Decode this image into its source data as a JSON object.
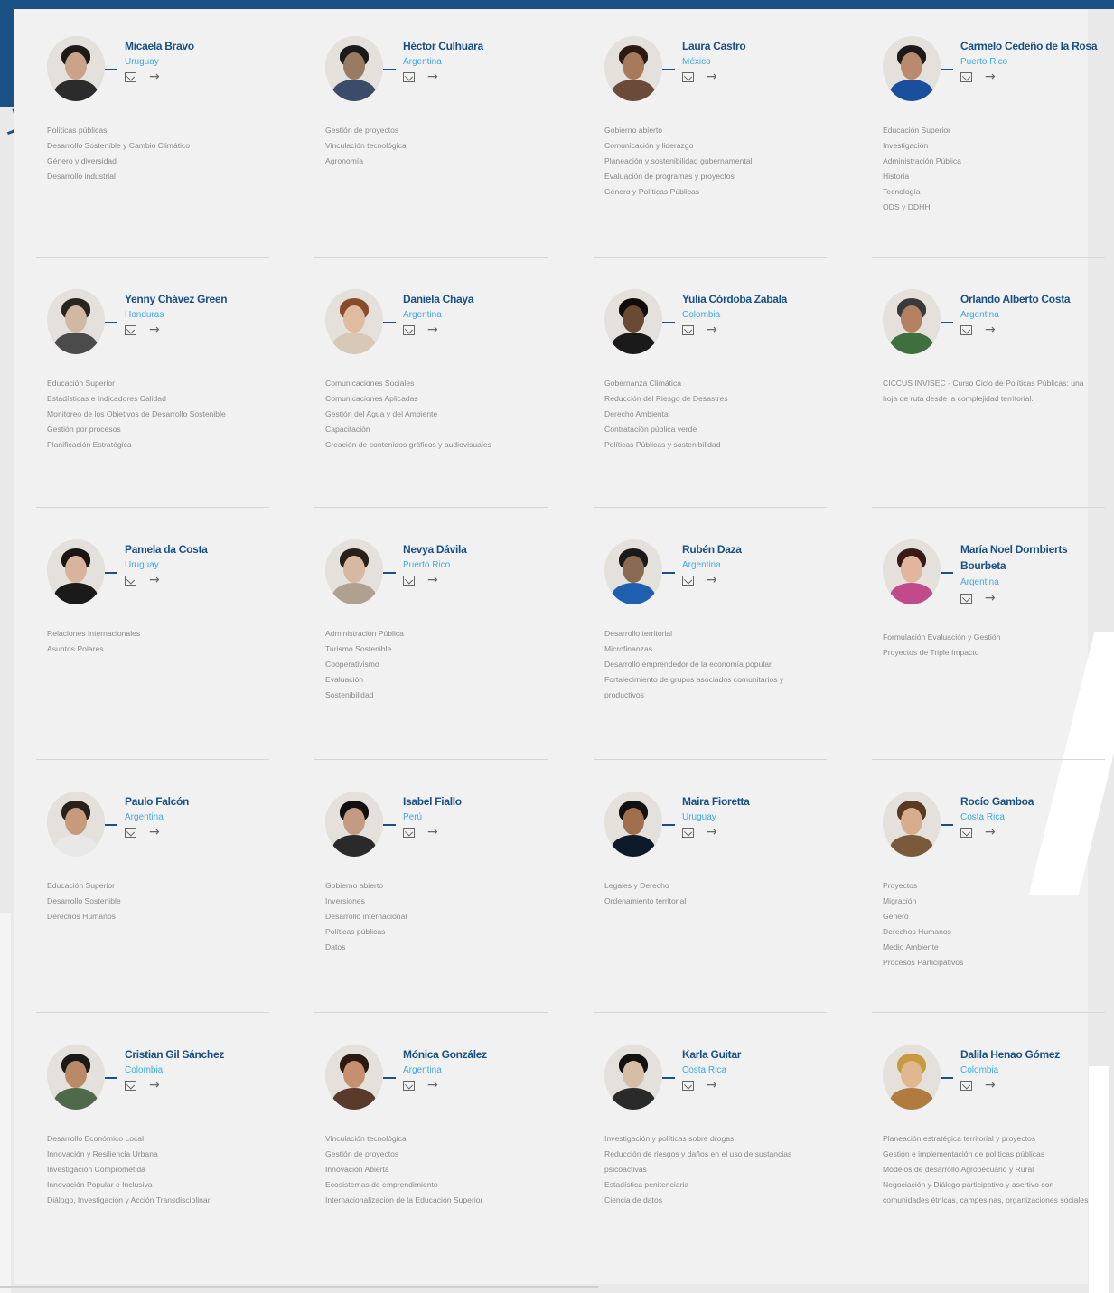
{
  "people": [
    {
      "name": "Micaela Bravo",
      "country": "Uruguay",
      "topics": [
        "Políticas públicas",
        "Desarrollo Sostenible y Cambio Climático",
        "Género y diversidad",
        "Desarrollo industrial"
      ]
    },
    {
      "name": "Héctor Culhuara",
      "country": "Argentina",
      "topics": [
        "Gestión de proyectos",
        "Vinculación tecnológica",
        "Agronomía"
      ]
    },
    {
      "name": "Laura Castro",
      "country": "México",
      "topics": [
        "Gobierno abierto",
        "Comunicación y liderazgo",
        "Planeación y sostenibilidad gubernamental",
        "Evaluación de programas y proyectos",
        "Género y Políticas Públicas"
      ]
    },
    {
      "name": "Carmelo Cedeño de la Rosa",
      "country": "Puerto Rico",
      "topics": [
        "Educación Superior",
        "Investigación",
        "Administración Pública",
        "Historia",
        "Tecnología",
        "ODS y DDHH"
      ]
    },
    {
      "name": "Yenny Chávez Green",
      "country": "Honduras",
      "topics": [
        "Educación Superior",
        "Estadísticas e Indicadores Calidad",
        "Monitoreo de los Objetivos de Desarrollo Sostenible",
        "Gestión por procesos",
        "Planificación Estratégica"
      ]
    },
    {
      "name": "Daniela Chaya",
      "country": "Argentina",
      "topics": [
        "Comunicaciones Sociales",
        "Comunicaciones Aplicadas",
        "Gestión del Agua y del Ambiente",
        "Capacitación",
        "Creación de contenidos gráficos y audiovisuales"
      ]
    },
    {
      "name": "Yulia Córdoba Zabala",
      "country": "Colombia",
      "topics": [
        "Gobernanza Climática",
        "Reducción del Riesgo de Desastres",
        "Derecho Ambiental",
        "Contratación pública verde",
        "Políticas Públicas y sostenibilidad"
      ]
    },
    {
      "name": "Orlando Alberto Costa",
      "country": "Argentina",
      "topics": [
        "CICCUS INVISEC - Curso Ciclo de Políticas Públicas: una hoja de ruta desde la complejidad territorial."
      ]
    },
    {
      "name": "Pamela da Costa",
      "country": "Uruguay",
      "topics": [
        "Relaciones Internacionales",
        "Asuntos Polares"
      ]
    },
    {
      "name": "Nevya Dávila",
      "country": "Puerto Rico",
      "topics": [
        "Administración Pública",
        "Turismo Sostenible",
        "Cooperativismo",
        "Evaluación",
        "Sostenibilidad"
      ]
    },
    {
      "name": "Rubén Daza",
      "country": "Argentina",
      "topics": [
        "Desarrollo territorial",
        "Microfinanzas",
        "Desarrollo emprendedor de la economía popular",
        "Fortalecimiento de grupos asociados comunitarios y productivos"
      ]
    },
    {
      "name": "María Noel Dornbierts Bourbeta",
      "country": "Argentina",
      "topics": [
        "Formulación Evaluación y Gestión",
        "Proyectos de Triple Impacto"
      ]
    },
    {
      "name": "Paulo Falcón",
      "country": "Argentina",
      "topics": [
        "Educación Superior",
        "Desarrollo Sostenible",
        "Derechos Humanos"
      ]
    },
    {
      "name": "Isabel Fiallo",
      "country": "Perú",
      "topics": [
        "Gobierno abierto",
        "Inversiones",
        "Desarrollo internacional",
        "Políticas públicas",
        "Datos"
      ]
    },
    {
      "name": "Maira Fioretta",
      "country": "Uruguay",
      "topics": [
        "Legales y Derecho",
        "Ordenamiento territorial"
      ]
    },
    {
      "name": "Rocío Gamboa",
      "country": "Costa Rica",
      "topics": [
        "Proyectos",
        "Migración",
        "Género",
        "Derechos Humanos",
        "Medio Ambiente",
        "Procesos Participativos"
      ]
    },
    {
      "name": "Cristian Gil Sánchez",
      "country": "Colombia",
      "topics": [
        "Desarrollo Económico Local",
        "Innovación y Resiliencia Urbana",
        "Investigación Comprometida",
        "Innovación Popular e Inclusiva",
        "Diálogo, Investigación y Acción Transdisciplinar"
      ]
    },
    {
      "name": "Mónica González",
      "country": "Argentina",
      "topics": [
        "Vinculación tecnológica",
        "Gestión de proyectos",
        "Innovación Abierta",
        "Ecosistemas de emprendimiento",
        "Internacionalización de la Educación Superior"
      ]
    },
    {
      "name": "Karla Guitar",
      "country": "Costa Rica",
      "topics": [
        "Investigación y políticas sobre drogas",
        "Reducción de riesgos y daños en el uso de sustancias psicoactivas",
        "Estadística penitenciaria",
        "Ciencia de datos"
      ]
    },
    {
      "name": "Dalila Henao Gómez",
      "country": "Colombia",
      "topics": [
        "Planeación estratégica territorial y proyectos",
        "Gestión e implementación de políticas públicas",
        "Modelos de desarrollo Agropecuario y Rural",
        "Negociación y Diálogo participativo y asertivo con comunidades étnicas, campesinas, organizaciones sociales"
      ]
    }
  ],
  "avatar_palettes": [
    [
      "#c9a48a",
      "#1d1a1a",
      "#2b2b2b"
    ],
    [
      "#9a7a63",
      "#1a1a1a",
      "#3b4b6a"
    ],
    [
      "#a77a5a",
      "#2a1a12",
      "#6b4a3a"
    ],
    [
      "#b98a6e",
      "#1c1a1a",
      "#1a4e9e"
    ],
    [
      "#d0b8a2",
      "#2a241f",
      "#4b4b4b"
    ],
    [
      "#e0bba0",
      "#8a4b2a",
      "#d8c8b8"
    ],
    [
      "#6b4a34",
      "#0f0c0b",
      "#1a1a1a"
    ],
    [
      "#b38060",
      "#3a3a3a",
      "#3f6e3f"
    ],
    [
      "#d9b39c",
      "#1a1414",
      "#1a1a1a"
    ],
    [
      "#d8b8a0",
      "#2a201a",
      "#b0a090"
    ],
    [
      "#8a6a52",
      "#1a1a1a",
      "#1f5fb0"
    ],
    [
      "#e2b59e",
      "#3a1a14",
      "#c04a8a"
    ],
    [
      "#c79a7e",
      "#2a201c",
      "#e8e8e8"
    ],
    [
      "#c49a80",
      "#141010",
      "#2a2a2a"
    ],
    [
      "#a0704e",
      "#121212",
      "#0c1a2a"
    ],
    [
      "#d8ad8e",
      "#5a3a22",
      "#7a5a3a"
    ],
    [
      "#b88a66",
      "#1a1a1a",
      "#4e6a4a"
    ],
    [
      "#c49070",
      "#2a1a12",
      "#5a3a2a"
    ],
    [
      "#d8bda6",
      "#111111",
      "#2a2a2a"
    ],
    [
      "#e0b890",
      "#c89a40",
      "#b07a40"
    ]
  ]
}
